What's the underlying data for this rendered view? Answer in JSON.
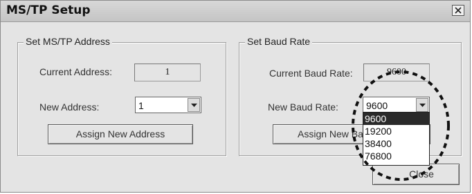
{
  "window": {
    "title": "MS/TP Setup"
  },
  "address_group": {
    "legend": "Set MS/TP Address",
    "current_label": "Current Address:",
    "current_value": "1",
    "new_label": "New Address:",
    "new_value": "1",
    "assign_button": "Assign New Address"
  },
  "baud_group": {
    "legend": "Set Baud Rate",
    "current_label": "Current Baud Rate:",
    "current_value": "9600",
    "new_label": "New Baud Rate:",
    "new_value": "9600",
    "assign_button_visible": "Assign New Ba",
    "options": [
      "9600",
      "19200",
      "38400",
      "76800"
    ],
    "selected_index": 0
  },
  "footer": {
    "close_button": "Close"
  },
  "icons": {
    "close": "close-x-icon",
    "dropdown_arrow": "chevron-down-icon"
  },
  "colors": {
    "dialog_bg": "#e4e4e4",
    "selection_bg": "#2a2a2a"
  }
}
